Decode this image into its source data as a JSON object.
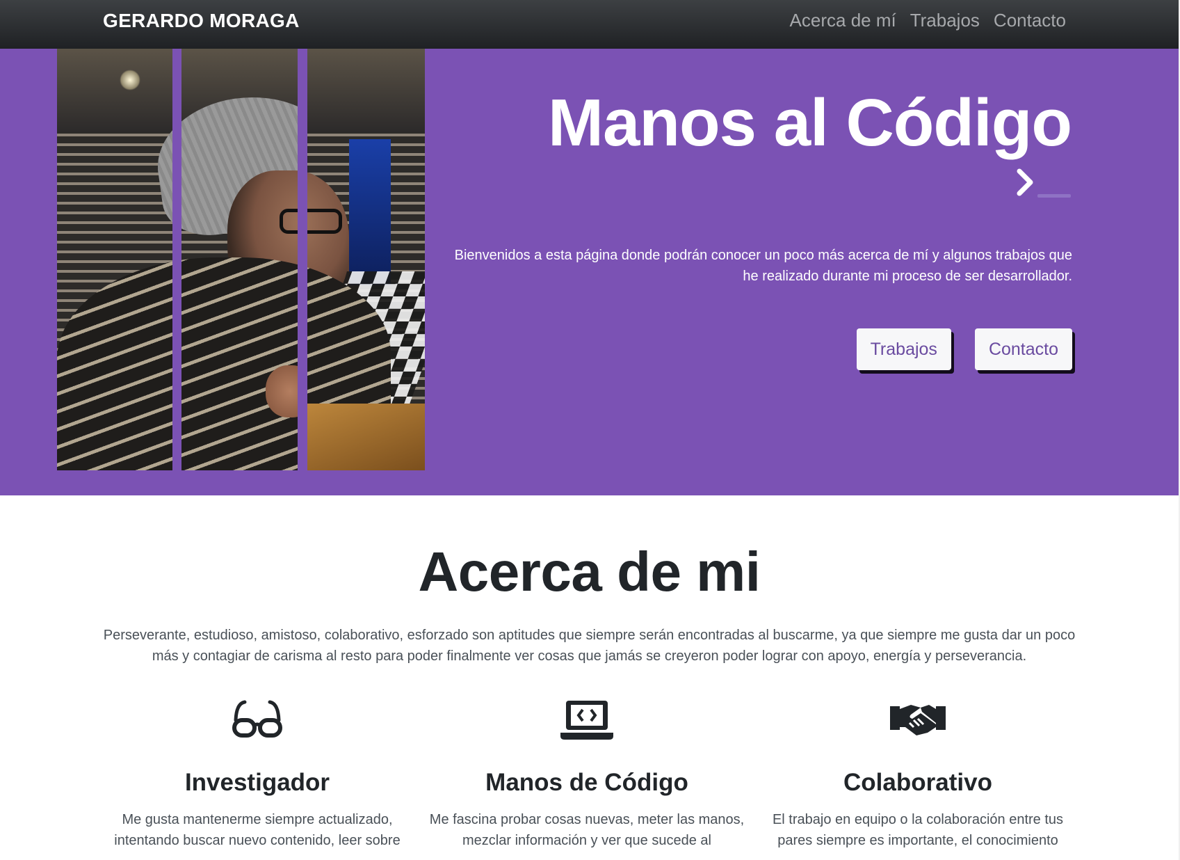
{
  "nav": {
    "brand": "GERARDO MORAGA",
    "links": [
      "Acerca de mí",
      "Trabajos",
      "Contacto"
    ]
  },
  "hero": {
    "title": "Manos al Código",
    "prompt_icon": "terminal-prompt-icon",
    "description": "Bienvenidos a esta página donde podrán conocer un poco más acerca de mí y algunos trabajos que he realizado durante mi proceso de ser desarrollador.",
    "buttons": [
      "Trabajos",
      "Contacto"
    ]
  },
  "about": {
    "title": "Acerca de mi",
    "description": "Perseverante, estudioso, amistoso, colaborativo, esforzado son aptitudes que siempre serán encontradas al buscarme, ya que siempre me gusta dar un poco más y contagiar de carisma al resto para poder finalmente ver cosas que jamás se creyeron poder lograr con apoyo, energía y perseverancia.",
    "features": [
      {
        "icon": "glasses-icon",
        "title": "Investigador",
        "text": "Me gusta mantenerme siempre actualizado, intentando buscar nuevo contenido, leer sobre"
      },
      {
        "icon": "laptop-code-icon",
        "title": "Manos de Código",
        "text": "Me fascina probar cosas nuevas, meter las manos, mezclar información y ver que sucede al"
      },
      {
        "icon": "handshake-icon",
        "title": "Colaborativo",
        "text": "El trabajo en equipo o la colaboración entre tus pares siempre es importante, el conocimiento"
      }
    ]
  },
  "colors": {
    "hero_bg": "#7b52b4",
    "navbar_bg": "#2b2d30",
    "button_text": "#6a4ba0"
  }
}
